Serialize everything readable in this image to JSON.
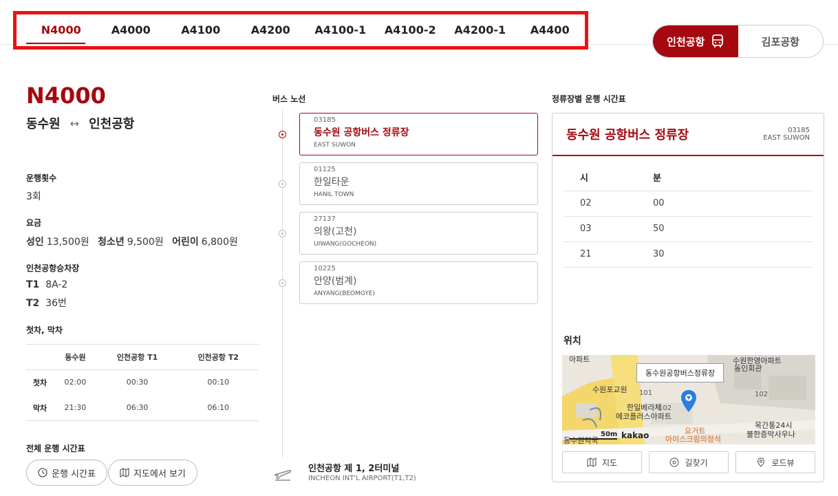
{
  "route_tabs": [
    "N4000",
    "A4000",
    "A4100",
    "A4200",
    "A4100-1",
    "A4100-2",
    "A4200-1",
    "A4400"
  ],
  "airport_switch": {
    "incheon": "인천공항",
    "gimpo": "김포공항"
  },
  "route": {
    "number": "N4000",
    "from": "동수원",
    "arrow": "↔",
    "to": "인천공항",
    "trips_label": "운행횟수",
    "trips_value": "3회",
    "fare_label": "요금",
    "fare": {
      "adult_label": "성인",
      "adult_value": "13,500원",
      "teen_label": "청소년",
      "teen_value": "9,500원",
      "child_label": "어린이",
      "child_value": "6,800원"
    },
    "boarding_label": "인천공항승차장",
    "t1_label": "T1",
    "t1_value": "8A-2",
    "t2_label": "T2",
    "t2_value": "36번",
    "first_last_label": "첫차, 막차",
    "first_last_table": {
      "headers": [
        "",
        "동수원",
        "인천공항 T1",
        "인천공항 T2"
      ],
      "rows": [
        [
          "첫차",
          "02:00",
          "00:30",
          "00:10"
        ],
        [
          "막차",
          "21:30",
          "06:30",
          "06:10"
        ]
      ]
    },
    "full_timetable_label": "전체 운행 시간표",
    "timetable_button": "운행 시간표",
    "map_view_button": "지도에서 보기"
  },
  "bus_route": {
    "title": "버스 노선",
    "stops": [
      {
        "code": "03185",
        "name": "동수원 공항버스 정류장",
        "en": "EAST SUWON"
      },
      {
        "code": "01125",
        "name": "한일타운",
        "en": "HANIL TOWN"
      },
      {
        "code": "27137",
        "name": "의왕(고천)",
        "en": "UIWANG(GOCHEON)"
      },
      {
        "code": "10225",
        "name": "안양(범계)",
        "en": "ANYANG(BEOMGYE)"
      }
    ],
    "terminal_name": "인천공항 제 1, 2터미널",
    "terminal_en": "INCHEON INT'L AIRPORT(T1,T2)"
  },
  "stop_timetable": {
    "title": "정류장별 운행 시간표",
    "stop_name": "동수원 공항버스 정류장",
    "stop_code": "03185",
    "stop_en": "EAST SUWON",
    "col_hour": "시",
    "col_min": "분",
    "rows": [
      [
        "02",
        "00"
      ],
      [
        "03",
        "50"
      ],
      [
        "21",
        "30"
      ]
    ],
    "location_label": "위치",
    "map": {
      "callout": "동수원공항버스정류장",
      "labels": [
        "수원포교원",
        "한일베라체",
        "에코플러스아파트",
        "요거트",
        "아이스크림의정석",
        "목간통24시",
        "불한증막사우나",
        "수원한영아파트",
        "동인회관",
        "동수원약국",
        "아파트",
        "102",
        "101",
        "102"
      ],
      "scale": "50m",
      "brand": "kakao"
    },
    "buttons": {
      "map": "지도",
      "directions": "길찾기",
      "roadview": "로드뷰"
    }
  }
}
